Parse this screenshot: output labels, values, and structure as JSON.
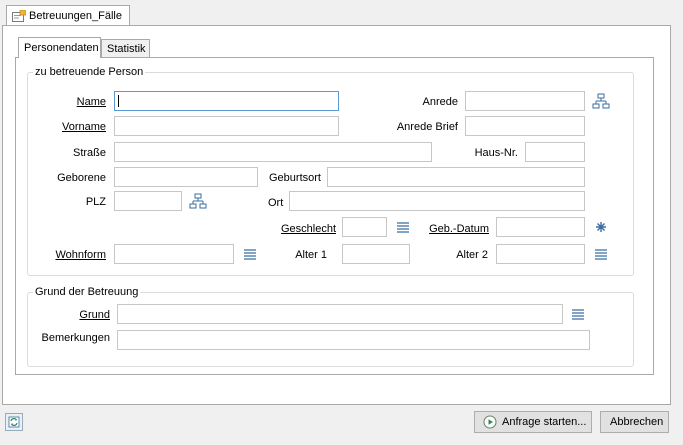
{
  "document_tab": {
    "label": "Betreuungen_Fälle",
    "icon": "form-document-icon"
  },
  "tabs": [
    {
      "label": "Personendaten",
      "active": true
    },
    {
      "label": "Statistik",
      "active": false
    }
  ],
  "group_person": {
    "title": "zu betreuende Person",
    "fields": {
      "name": {
        "label": "Name",
        "value": ""
      },
      "vorname": {
        "label": "Vorname",
        "value": ""
      },
      "strasse": {
        "label": "Straße",
        "value": ""
      },
      "geborene": {
        "label": "Geborene",
        "value": ""
      },
      "plz": {
        "label": "PLZ",
        "value": ""
      },
      "wohnform": {
        "label": "Wohnform",
        "value": ""
      },
      "anrede": {
        "label": "Anrede",
        "value": ""
      },
      "anrede_brief": {
        "label": "Anrede Brief",
        "value": ""
      },
      "haus_nr": {
        "label": "Haus-Nr.",
        "value": ""
      },
      "geburtsort": {
        "label": "Geburtsort",
        "value": ""
      },
      "ort": {
        "label": "Ort",
        "value": ""
      },
      "geschlecht": {
        "label": "Geschlecht",
        "value": ""
      },
      "alter1": {
        "label": "Alter 1",
        "value": ""
      },
      "geb_datum": {
        "label": "Geb.-Datum",
        "value": ""
      },
      "alter2": {
        "label": "Alter 2",
        "value": ""
      }
    }
  },
  "group_grund": {
    "title": "Grund der Betreuung",
    "fields": {
      "grund": {
        "label": "Grund",
        "value": ""
      },
      "bemerkungen": {
        "label": "Bemerkungen",
        "value": ""
      }
    }
  },
  "footer": {
    "refresh_icon": "refresh-icon",
    "query_button": "Anfrage starten...",
    "cancel_button": "Abbrechen"
  },
  "colors": {
    "focus_border": "#5a9bd5",
    "icon_blue": "#3a6ea5"
  }
}
